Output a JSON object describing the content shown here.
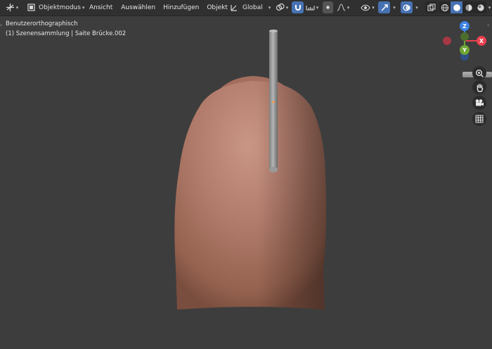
{
  "header": {
    "editor_type_icon": "axis-gizmo-icon",
    "mode": "Objektmodus",
    "mode_icon": "object-mode-icon",
    "menus": [
      "Ansicht",
      "Auswählen",
      "Hinzufügen",
      "Objekt"
    ],
    "transform_orientation": "Global",
    "transform_orientation_icon": "orientation-icon",
    "pivot_icon": "pivot-point-icon",
    "snap_icon": "snap-magnet-icon",
    "snap_target_icon": "snap-increment-icon",
    "proportional_icon": "proportional-edit-icon",
    "falloff_icon": "falloff-curve-icon",
    "visibility_icon": "visibility-eye-icon",
    "gizmo_toggle_icon": "gizmo-icon",
    "overlay_icon": "overlays-icon",
    "xray_icon": "xray-icon",
    "shading_modes": [
      "wireframe",
      "solid",
      "material-preview",
      "rendered"
    ],
    "active_shading": "solid"
  },
  "viewport": {
    "view_name": "Benutzerorthographisch",
    "collection_line": "(1) Szenensammlung | Saite Brücke.002"
  },
  "navigation_gizmo": {
    "axes": {
      "z": "Z",
      "x": "X",
      "y": "Y"
    },
    "colors": {
      "x": "#e8414f",
      "y": "#6ea535",
      "z": "#3d82e2",
      "x_neg": "#a53845",
      "y_neg": "#4d6d2c",
      "z_neg": "#2d4f86"
    },
    "buttons": [
      "zoom-icon",
      "hand-pan-icon",
      "camera-icon",
      "ortho-grid-icon"
    ]
  },
  "scene": {
    "body_color": "#c58a79",
    "rod_color": "#9c9c9c",
    "background": "#3d3d3d"
  }
}
